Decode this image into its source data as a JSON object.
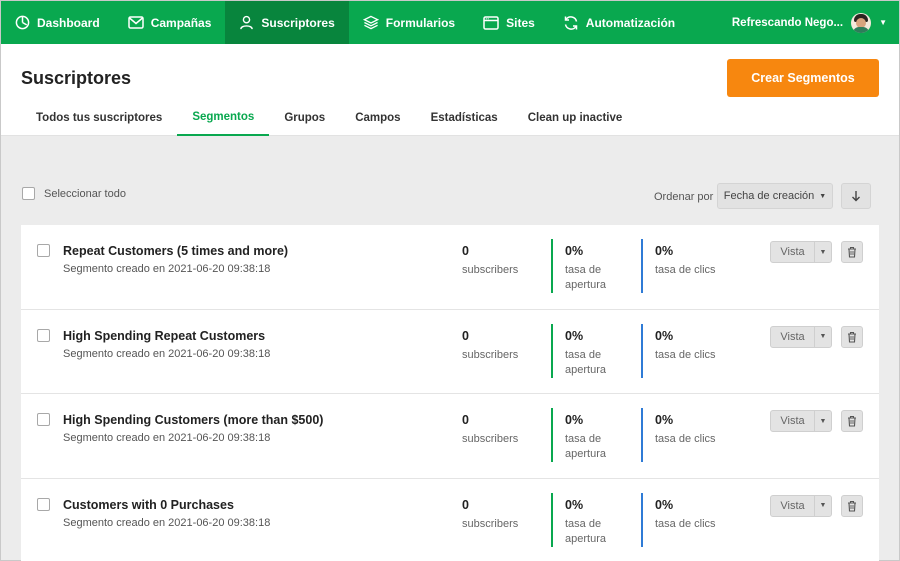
{
  "nav": {
    "items": [
      {
        "label": "Dashboard",
        "icon": "dashboard-icon"
      },
      {
        "label": "Campañas",
        "icon": "mail-icon"
      },
      {
        "label": "Suscriptores",
        "icon": "user-icon",
        "active": true
      },
      {
        "label": "Formularios",
        "icon": "layers-icon"
      },
      {
        "label": "Sites",
        "icon": "browser-icon"
      },
      {
        "label": "Automatización",
        "icon": "refresh-icon"
      }
    ],
    "account_name": "Refrescando Nego...",
    "brand_color": "#09a84f"
  },
  "header": {
    "title": "Suscriptores",
    "cta_label": "Crear Segmentos",
    "cta_color": "#f7870f",
    "tabs": [
      {
        "label": "Todos tus suscriptores"
      },
      {
        "label": "Segmentos",
        "active": true
      },
      {
        "label": "Grupos"
      },
      {
        "label": "Campos"
      },
      {
        "label": "Estadísticas"
      },
      {
        "label": "Clean up inactive"
      }
    ]
  },
  "toolbar": {
    "select_all": "Seleccionar todo",
    "sort_label": "Ordenar por",
    "sort_value": "Fecha de creación"
  },
  "segments": [
    {
      "name": "Repeat Customers (5 times and more)",
      "created": "Segmento creado en 2021-06-20 09:38:18",
      "subscribers": "0",
      "subscribers_label": "subscribers",
      "open_rate": "0%",
      "open_label": "tasa de apertura",
      "click_rate": "0%",
      "click_label": "tasa de clics",
      "view_label": "Vista"
    },
    {
      "name": "High Spending Repeat Customers",
      "created": "Segmento creado en 2021-06-20 09:38:18",
      "subscribers": "0",
      "subscribers_label": "subscribers",
      "open_rate": "0%",
      "open_label": "tasa de apertura",
      "click_rate": "0%",
      "click_label": "tasa de clics",
      "view_label": "Vista"
    },
    {
      "name": "High Spending Customers (more than $500)",
      "created": "Segmento creado en 2021-06-20 09:38:18",
      "subscribers": "0",
      "subscribers_label": "subscribers",
      "open_rate": "0%",
      "open_label": "tasa de apertura",
      "click_rate": "0%",
      "click_label": "tasa de clics",
      "view_label": "Vista"
    },
    {
      "name": "Customers with 0 Purchases",
      "created": "Segmento creado en 2021-06-20 09:38:18",
      "subscribers": "0",
      "subscribers_label": "subscribers",
      "open_rate": "0%",
      "open_label": "tasa de apertura",
      "click_rate": "0%",
      "click_label": "tasa de clics",
      "view_label": "Vista"
    }
  ]
}
